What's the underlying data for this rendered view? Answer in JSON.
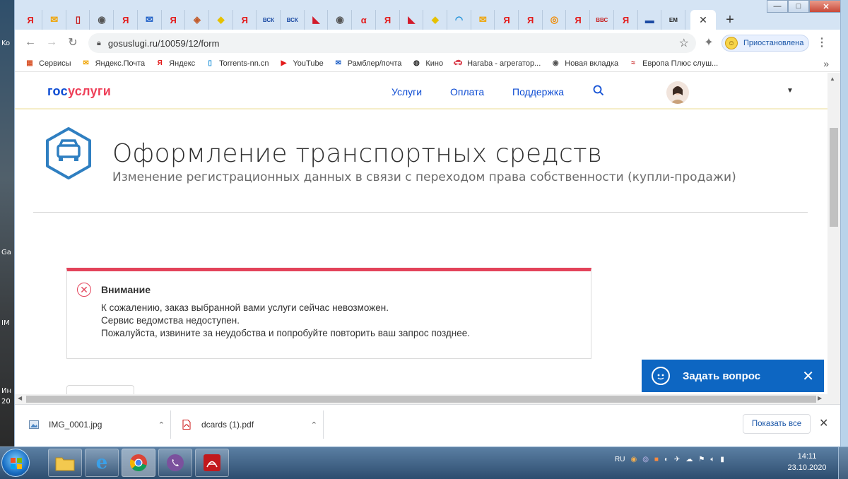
{
  "desktop": {
    "edge_labels": [
      "Ko",
      "Ga",
      "IM",
      "Ин",
      "20"
    ]
  },
  "browser": {
    "tabs": [
      {
        "glyph": "Я",
        "color": "#e31b1b"
      },
      {
        "glyph": "✉",
        "color": "#f0a300"
      },
      {
        "glyph": "▯",
        "color": "#c61f1f"
      },
      {
        "glyph": "◉",
        "color": "#555555"
      },
      {
        "glyph": "Я",
        "color": "#e31b1b"
      },
      {
        "glyph": "✉",
        "color": "#1b5dc6"
      },
      {
        "glyph": "Я",
        "color": "#e31b1b"
      },
      {
        "glyph": "◈",
        "color": "#c25a2a"
      },
      {
        "glyph": "◆",
        "color": "#e6c100"
      },
      {
        "glyph": "Я",
        "color": "#e31b1b"
      },
      {
        "glyph": "ВСК",
        "color": "#1b4aa3"
      },
      {
        "glyph": "ВСК",
        "color": "#1b4aa3"
      },
      {
        "glyph": "◣",
        "color": "#d21b2b"
      },
      {
        "glyph": "◉",
        "color": "#555555"
      },
      {
        "glyph": "α",
        "color": "#e31b1b"
      },
      {
        "glyph": "Я",
        "color": "#e31b1b"
      },
      {
        "glyph": "◣",
        "color": "#d21b2b"
      },
      {
        "glyph": "◆",
        "color": "#e6c100"
      },
      {
        "glyph": "◠",
        "color": "#1a8fd8"
      },
      {
        "glyph": "✉",
        "color": "#f0a300"
      },
      {
        "glyph": "Я",
        "color": "#e31b1b"
      },
      {
        "glyph": "Я",
        "color": "#e31b1b"
      },
      {
        "glyph": "◎",
        "color": "#f08a00"
      },
      {
        "glyph": "Я",
        "color": "#e31b1b"
      },
      {
        "glyph": "ВВС",
        "color": "#c61f1f"
      },
      {
        "glyph": "Я",
        "color": "#e31b1b"
      },
      {
        "glyph": "▬",
        "color": "#1b4aa3"
      },
      {
        "glyph": "ЕМ",
        "color": "#222222"
      }
    ],
    "active_tab_close": "✕",
    "new_tab": "+",
    "window_controls": {
      "minimize": "—",
      "maximize": "□",
      "close": "✕"
    },
    "url": "gosuslugi.ru/10059/12/form",
    "profile_label": "Приостановлена",
    "bookmarks": [
      {
        "label": "Сервисы",
        "icon": "apps-icon",
        "color": "#d9552b"
      },
      {
        "label": "Яндекс.Почта",
        "icon": "mail-icon",
        "color": "#f0a300"
      },
      {
        "label": "Яндекс",
        "icon": "yandex-icon",
        "color": "#e31b1b"
      },
      {
        "label": "Torrents-nn.cn",
        "icon": "torrent-icon",
        "color": "#1a8fd8"
      },
      {
        "label": "YouTube",
        "icon": "youtube-icon",
        "color": "#e31b1b"
      },
      {
        "label": "Рамблер/почта",
        "icon": "mail-icon",
        "color": "#1b5dc6"
      },
      {
        "label": "Кино",
        "icon": "film-icon",
        "color": "#222222"
      },
      {
        "label": "Haraba - агрегатор...",
        "icon": "car-icon",
        "color": "#d21b2b"
      },
      {
        "label": "Новая вкладка",
        "icon": "globe-icon",
        "color": "#555555"
      },
      {
        "label": "Европа Плюс слуш...",
        "icon": "radio-icon",
        "color": "#c61f1f"
      }
    ],
    "bookmarks_more": "»"
  },
  "site": {
    "logo_a": "гос",
    "logo_b": "услуги",
    "nav": [
      "Услуги",
      "Оплата",
      "Поддержка"
    ],
    "service_title": "Оформление транспортных средств",
    "service_subtitle": "Изменение регистрационных данных в связи с переходом права собственности (купли-продажи)",
    "alert": {
      "title": "Внимание",
      "lines": [
        "К сожалению, заказ выбранной вами услуги сейчас невозможен.",
        "Сервис ведомства недоступен.",
        "Пожалуйста, извините за неудобства и попробуйте повторить ваш запрос позднее."
      ],
      "accent": "#e3435a"
    },
    "ask_label": "Задать вопрос",
    "brand_blue": "#0d4cd3"
  },
  "downloads": {
    "items": [
      {
        "name": "IMG_0001.jpg",
        "icon": "image-file-icon"
      },
      {
        "name": "dcards (1).pdf",
        "icon": "pdf-file-icon"
      }
    ],
    "show_all": "Показать все"
  },
  "taskbar": {
    "language": "RU",
    "time": "14:11",
    "date": "23.10.2020"
  }
}
